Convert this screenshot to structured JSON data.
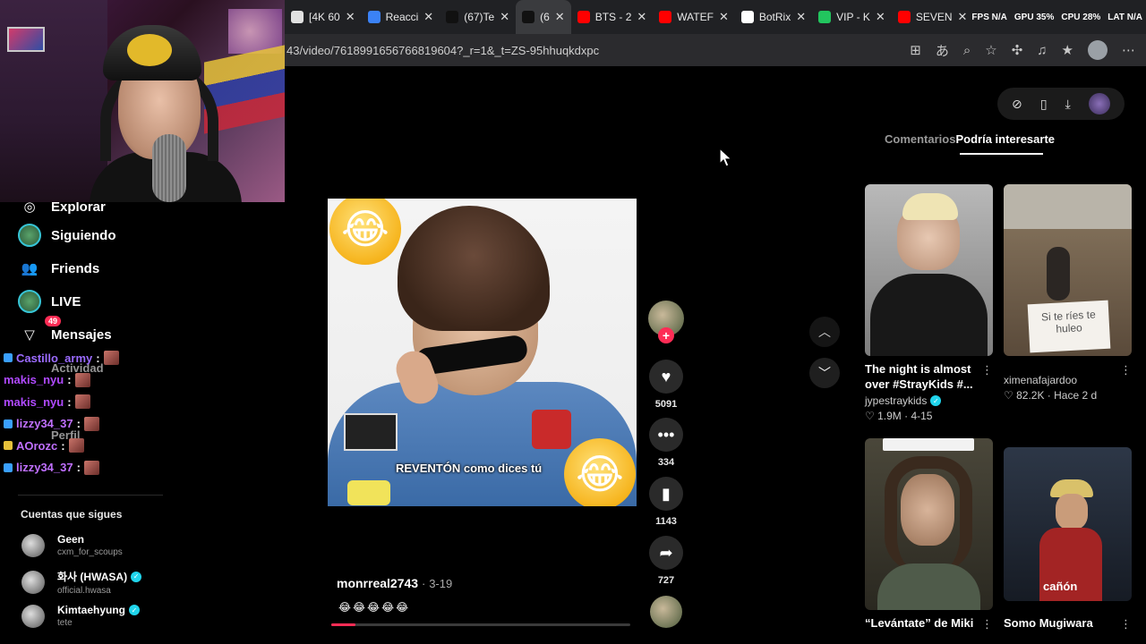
{
  "browser": {
    "tabs": [
      {
        "label": "[4K 60",
        "fav_color": "#e1e1e1",
        "active": false
      },
      {
        "label": "Reacci",
        "fav_color": "#3b82f6",
        "active": false
      },
      {
        "label": "(67)Te",
        "fav_color": "#111111",
        "active": false
      },
      {
        "label": "(6",
        "fav_color": "#111111",
        "active": true
      },
      {
        "label": "BTS - 2",
        "fav_color": "#ff0000",
        "active": false
      },
      {
        "label": "WATEF",
        "fav_color": "#ff0000",
        "active": false
      },
      {
        "label": "BotRix",
        "fav_color": "#ffffff",
        "active": false
      },
      {
        "label": "VIP - K",
        "fav_color": "#22c55e",
        "active": false
      },
      {
        "label": "SEVEN",
        "fav_color": "#ff0000",
        "active": false
      }
    ],
    "close_glyph": "✕",
    "stats": [
      {
        "label": "FPS",
        "value": "N/A"
      },
      {
        "label": "GPU",
        "value": "35%"
      },
      {
        "label": "CPU",
        "value": "28%"
      },
      {
        "label": "LAT",
        "value": "N/A"
      }
    ],
    "url": "43/video/7618991656766819604?_r=1&_t=ZS-95hhuqkdxpc"
  },
  "sidebar": {
    "nav": [
      {
        "label": "Explorar",
        "icon": "compass-icon"
      },
      {
        "label": "Siguiendo",
        "icon": "following-avatar-icon"
      },
      {
        "label": "Friends",
        "icon": "friends-icon"
      },
      {
        "label": "LIVE",
        "icon": "live-icon"
      },
      {
        "label": "Mensajes",
        "icon": "messages-icon",
        "badge": "49"
      }
    ],
    "ghost_items": [
      "Actividad",
      "Perfil"
    ],
    "chat": [
      {
        "user": "Castillo_army",
        "color": "#9b6bff",
        "emblem": "#3aa0ff"
      },
      {
        "user": "makis_nyu",
        "color": "#b04aff",
        "emblem": ""
      },
      {
        "user": "makis_nyu",
        "color": "#b04aff",
        "emblem": ""
      },
      {
        "user": "lizzy34_37",
        "color": "#c070ff",
        "emblem": "#3aa0ff"
      },
      {
        "user": "AOrozc",
        "color": "#c070ff",
        "emblem": "#e5c03a"
      },
      {
        "user": "lizzy34_37",
        "color": "#c070ff",
        "emblem": "#3aa0ff"
      }
    ],
    "following_heading": "Cuentas que sigues",
    "following": [
      {
        "name": "Geen",
        "handle": "cxm_for_scoups",
        "verified": false
      },
      {
        "name": "화사 (HWASA)",
        "handle": "official.hwasa",
        "verified": true
      },
      {
        "name": "Kimtaehyung",
        "handle": "tete",
        "verified": true
      }
    ]
  },
  "video": {
    "caption": "REVENTÓN como dices tú",
    "author": "monrreal2743",
    "date": "3-19",
    "emojis": "😂😂😂😂😂",
    "progress": 0.08,
    "likes": "5091",
    "comments": "334",
    "saves": "1143",
    "shares": "727"
  },
  "right_panel": {
    "tabs": [
      "Comentarios",
      "Podría interesarte"
    ],
    "cards": [
      {
        "title": "The night is almost over #StrayKids #...",
        "author": "jypestraykids",
        "verified": true,
        "meta": "1.9M · 4-15",
        "thumb": "#5d5d5d"
      },
      {
        "title": "",
        "author": "ximenafajardoo",
        "verified": false,
        "meta": "82.2K · Hace 2 d",
        "thumb": "#6b5a44"
      },
      {
        "title": "“Levántate” de Miki",
        "author": "",
        "verified": false,
        "meta": "",
        "thumb": "#3b3a30"
      },
      {
        "title": "Somo Mugiwara",
        "author": "",
        "verified": false,
        "meta": "",
        "thumb": "#2d3747"
      }
    ],
    "overlay_texts": [
      "Si te ríes te huleo",
      "cañón"
    ]
  }
}
